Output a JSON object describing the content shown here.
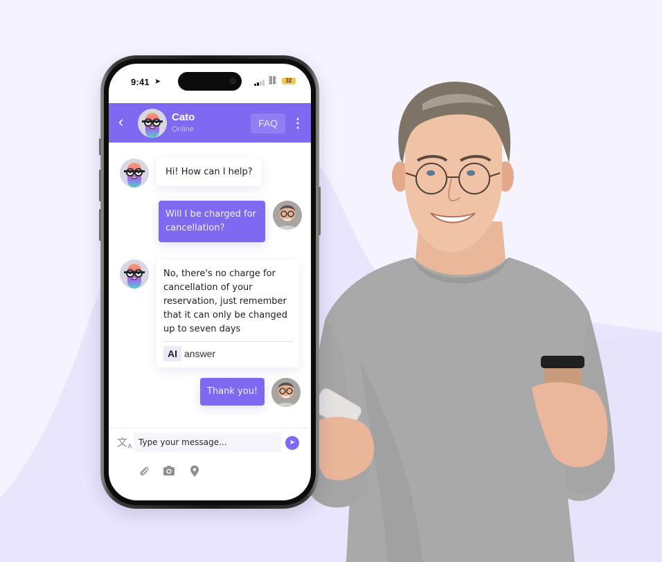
{
  "colors": {
    "background": "#f4f3fe",
    "background_wave": "#e8e5fc",
    "accent": "#8069f1",
    "bubble_in": "#ffffff",
    "bubble_out": "#8069f1"
  },
  "status_bar": {
    "time": "9:41",
    "location_icon": "location-arrow-icon",
    "signal_icon": "signal-bars-icon",
    "link_icon": "link-icon",
    "battery": "32"
  },
  "chat_header": {
    "back_icon": "chevron-left-icon",
    "bot_name": "Cato",
    "bot_status": "Online",
    "faq_label": "FAQ",
    "menu_icon": "kebab-menu-icon"
  },
  "messages": [
    {
      "sender": "bot",
      "text": "Hi! How can I help?"
    },
    {
      "sender": "user",
      "lines": [
        "Will I be charged for",
        "cancellation?"
      ]
    },
    {
      "sender": "bot",
      "lines": [
        "No, there's no charge for",
        "cancellation of your",
        "reservation, just remember",
        "that it can only be changed",
        "up to seven days"
      ],
      "tag": "AI",
      "tag_text": "answer"
    },
    {
      "sender": "user",
      "text": "Thank you!"
    }
  ],
  "composer": {
    "translate_icon": "translate-icon",
    "placeholder": "Type your message...",
    "send_icon": "send-icon",
    "tools": [
      "paperclip-icon",
      "camera-icon",
      "map-pin-icon"
    ]
  }
}
